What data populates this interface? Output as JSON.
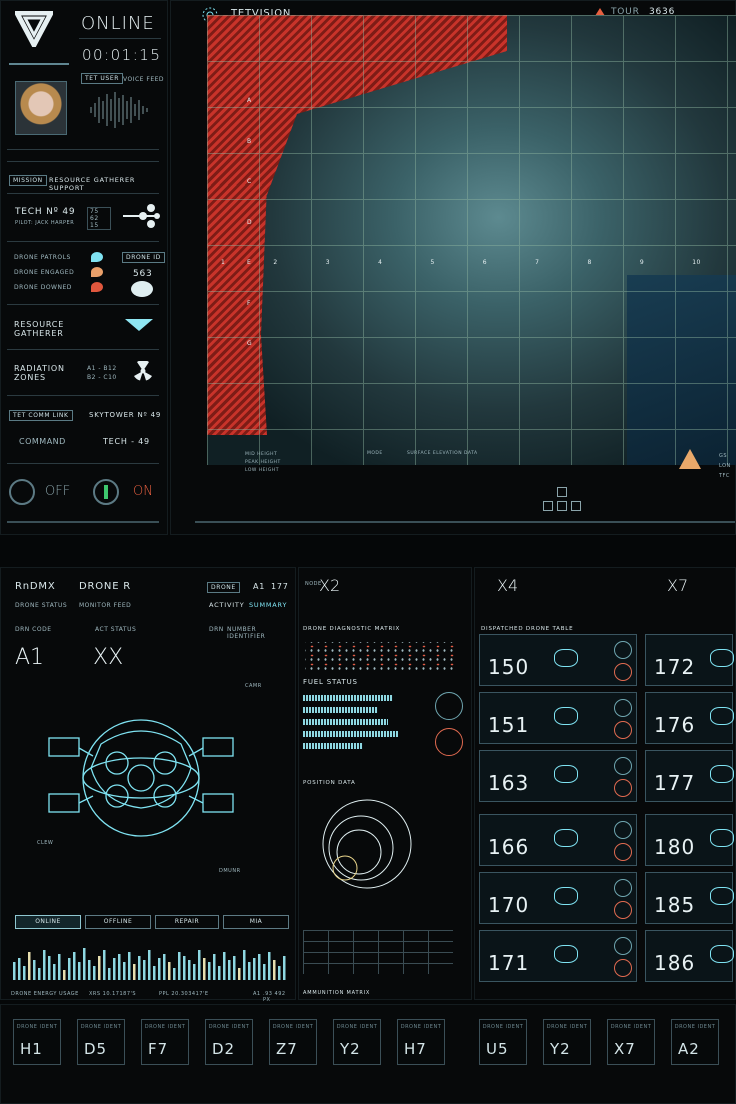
{
  "status": {
    "state": "ONLINE",
    "timer": "00:01:15",
    "tet_user": "TET USER",
    "voice_feed": "VOICE FEED"
  },
  "mission": {
    "label": "MISSION",
    "value": "RESOURCE GATHERER SUPPORT"
  },
  "tech": {
    "label": "TECH Nº 49",
    "pilot": "PILOT: JACK HARPER",
    "codes": [
      "75",
      "62",
      "15"
    ],
    "code_suffix": [
      "R",
      "G",
      "R"
    ]
  },
  "drones": {
    "patrols": "DRONE PATROLS",
    "engaged": "DRONE ENGAGED",
    "downed": "DRONE DOWNED",
    "id_label": "DRONE ID",
    "id_value": "563"
  },
  "resource": {
    "label1": "RESOURCE",
    "label2": "GATHERER"
  },
  "radiation": {
    "label1": "RADIATION",
    "label2": "ZONES",
    "codes1": "A1 - B12",
    "codes2": "B2 - C10"
  },
  "comm": {
    "label": "TET COMM LINK",
    "tower": "SKYTOWER Nº 49",
    "command": "COMMAND",
    "tech": "TECH - 49",
    "off": "OFF",
    "on": "ON"
  },
  "map": {
    "title": "TETVISION",
    "tour_label": "TOUR",
    "tour_value": "3636",
    "rows": [
      "A",
      "B",
      "C",
      "D",
      "E",
      "F",
      "G"
    ],
    "cols": [
      "1",
      "2",
      "3",
      "4",
      "5",
      "6",
      "7",
      "8",
      "9",
      "10"
    ],
    "legend": [
      "MID HEIGHT",
      "PEAK HEIGHT",
      "LOW HEIGHT"
    ],
    "surface": "SURFACE ELEVATION DATA",
    "mode": "MODE",
    "readouts": [
      "GS",
      "LON",
      "TFC"
    ]
  },
  "drone_panel": {
    "rndmx": "RnDMX",
    "drone_r": "DRONE R",
    "drone_label": "DRONE",
    "drone_id": "A1",
    "drone_num": "177",
    "drone_status": "DRONE STATUS",
    "monitor_feed": "MONITOR FEED",
    "activity": "ACTIVITY",
    "summary": "SUMMARY",
    "drn_code": "DRN CODE",
    "act_status": "ACT STATUS",
    "drn": "DRN",
    "number_identifier": "NUMBER IDENTIFIER",
    "code_value": "A1",
    "status_value": "XX",
    "callouts": [
      "CAMR",
      "CLEW",
      "DMUNR"
    ],
    "buttons": [
      "ONLINE",
      "OFFLINE",
      "REPAIR",
      "MIA"
    ],
    "energy": "DRONE ENERGY USAGE",
    "xrs": "XRS 10.17187'S",
    "ppl": "PPL 20.303417'E",
    "a1": "A1",
    "px": ".93 492 PX"
  },
  "diagnostic": {
    "node1": "NODE",
    "node1_val": "X2",
    "matrix": "DRONE DIAGNOSTIC MATRIX",
    "fuel": "FUEL STATUS",
    "fuel_levels": [
      0.9,
      0.75,
      0.85,
      0.95,
      0.6
    ],
    "position": "POSITION DATA",
    "ammunition": "AMMUNITION MATRIX"
  },
  "dispatched": {
    "node_a": "X4",
    "node_b": "X7",
    "title": "DISPATCHED DRONE TABLE",
    "left": [
      "150",
      "151",
      "163",
      "166",
      "170",
      "171"
    ],
    "right": [
      "172",
      "176",
      "177",
      "180",
      "185",
      "186"
    ]
  },
  "idents": {
    "label": "DRONE IDENT",
    "values": [
      "H1",
      "D5",
      "F7",
      "D2",
      "Z7",
      "Y2",
      "H7",
      "U5",
      "Y2",
      "X7",
      "A2"
    ]
  }
}
